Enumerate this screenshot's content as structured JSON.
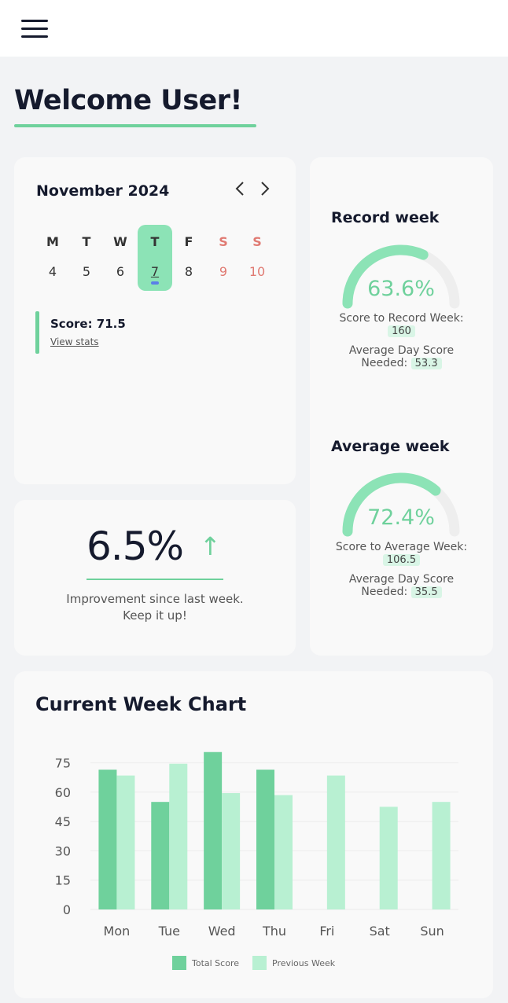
{
  "header": {
    "menu_icon": "hamburger-menu-icon"
  },
  "welcome": {
    "title": "Welcome User!"
  },
  "calendar": {
    "month_label": "November 2024",
    "days": [
      {
        "name": "M",
        "date": "4",
        "weekend": false,
        "today": false
      },
      {
        "name": "T",
        "date": "5",
        "weekend": false,
        "today": false
      },
      {
        "name": "W",
        "date": "6",
        "weekend": false,
        "today": false
      },
      {
        "name": "T",
        "date": "7",
        "weekend": false,
        "today": true
      },
      {
        "name": "F",
        "date": "8",
        "weekend": false,
        "today": false
      },
      {
        "name": "S",
        "date": "9",
        "weekend": true,
        "today": false
      },
      {
        "name": "S",
        "date": "10",
        "weekend": true,
        "today": false
      }
    ],
    "score_label": "Score: 71.5",
    "view_stats": "View stats"
  },
  "improvement": {
    "value": "6.5%",
    "line1": "Improvement since last week.",
    "line2": "Keep it up!"
  },
  "record_week": {
    "title": "Record week",
    "percent": "63.6%",
    "fraction": 0.636,
    "score_label": "Score to Record Week:",
    "score_value": "160",
    "avg_label_1": "Average Day Score",
    "avg_label_2": "Needed:",
    "avg_value": "53.3"
  },
  "average_week": {
    "title": "Average week",
    "percent": "72.4%",
    "fraction": 0.724,
    "score_label": "Score to Average Week:",
    "score_value": "106.5",
    "avg_label_1": "Average Day Score",
    "avg_label_2": "Needed:",
    "avg_value": "35.5"
  },
  "colors": {
    "accent": "#6fd19c",
    "accent_light": "#b8f0d2",
    "weekend": "#e07a72",
    "track": "#eeeeee"
  },
  "chart_data": {
    "type": "bar",
    "title": "Current Week Chart",
    "categories": [
      "Mon",
      "Tue",
      "Wed",
      "Thu",
      "Fri",
      "Sat",
      "Sun"
    ],
    "y_ticks": [
      "0",
      "15",
      "30",
      "45",
      "60",
      "75"
    ],
    "ylim": [
      0,
      80
    ],
    "series": [
      {
        "name": "Total Score",
        "color": "#6fd19c",
        "values": [
          71.5,
          55,
          80.5,
          71.5,
          null,
          null,
          null
        ]
      },
      {
        "name": "Previous Week",
        "color": "#b8f0d2",
        "values": [
          68.5,
          74.5,
          59.5,
          58.5,
          68.5,
          52.5,
          55
        ]
      }
    ],
    "legend_position": "bottom",
    "grid": true
  }
}
